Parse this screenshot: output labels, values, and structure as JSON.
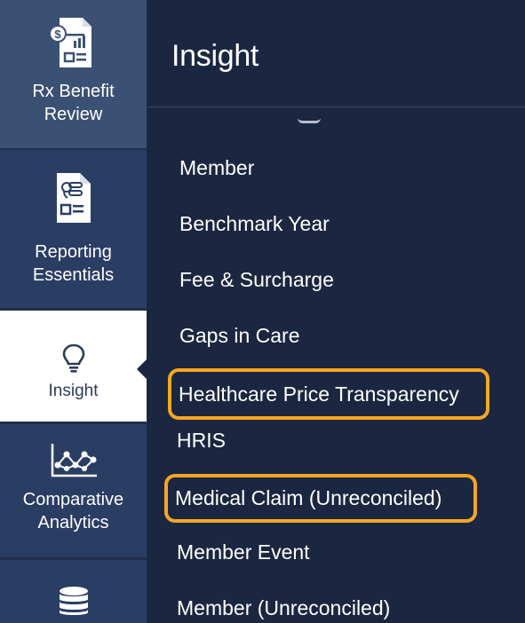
{
  "sidebar": {
    "items": [
      {
        "label_line1": "Rx Benefit",
        "label_line2": "Review",
        "icon": "rx-report-icon"
      },
      {
        "label_line1": "Reporting",
        "label_line2": "Essentials",
        "icon": "clipboard-report-icon"
      },
      {
        "label_line1": "Insight",
        "icon": "lightbulb-icon",
        "active": true
      },
      {
        "label_line1": "Comparative",
        "label_line2": "Analytics",
        "icon": "network-chart-icon"
      },
      {
        "icon": "database-icon"
      }
    ]
  },
  "panel": {
    "title": "Insight",
    "menu": [
      {
        "label": "Member"
      },
      {
        "label": "Benchmark Year"
      },
      {
        "label": "Fee & Surcharge"
      },
      {
        "label": "Gaps in Care"
      },
      {
        "label": "Healthcare Price Transparency",
        "highlighted": true
      },
      {
        "label": "HRIS"
      },
      {
        "label": "Medical Claim (Unreconciled)",
        "highlighted": true
      },
      {
        "label": "Member Event"
      },
      {
        "label": "Member (Unreconciled)"
      }
    ]
  },
  "colors": {
    "rail": "#2a3d63",
    "rail_top": "#3b5173",
    "panel": "#1b2740",
    "active": "#ffffff",
    "highlight": "#f5a623"
  }
}
